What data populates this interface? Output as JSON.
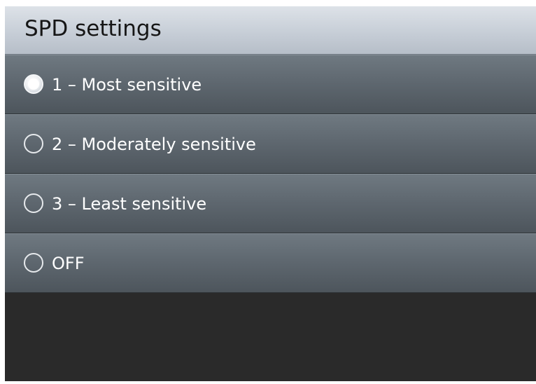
{
  "header": {
    "title": "SPD settings"
  },
  "options": [
    {
      "label": "1 – Most sensitive",
      "selected": true
    },
    {
      "label": "2 – Moderately sensitive",
      "selected": false
    },
    {
      "label": "3 – Least sensitive",
      "selected": false
    },
    {
      "label": "OFF",
      "selected": false
    }
  ],
  "colors": {
    "header_bg": "#c7ced7",
    "row_bg": "#5f6870",
    "screen_bg": "#2a2a2a",
    "text": "#ffffff"
  },
  "icons": {
    "selected": "radio-selected-icon",
    "unselected": "radio-unselected-icon"
  }
}
